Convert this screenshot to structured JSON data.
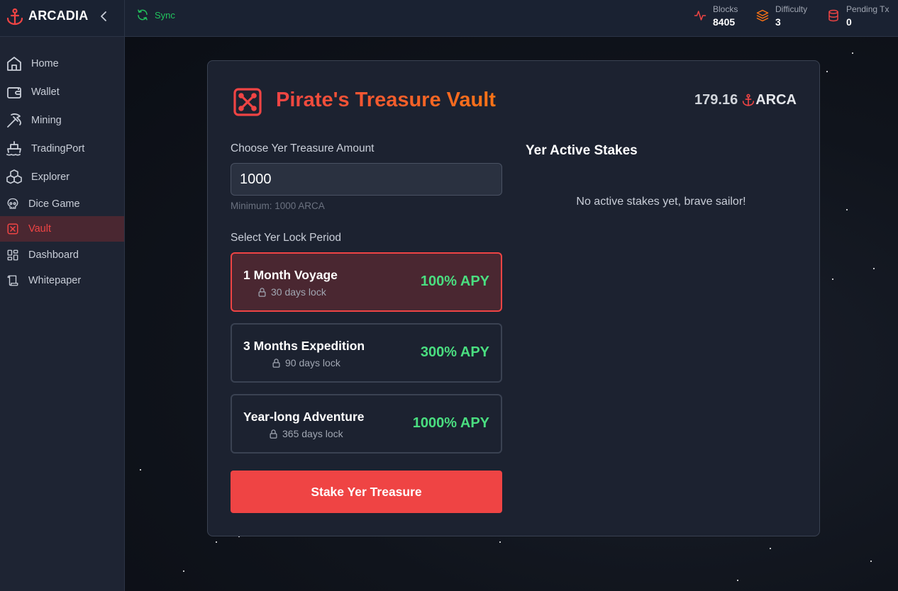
{
  "header": {
    "brand": "ARCADIA",
    "sync_label": "Sync",
    "stats": [
      {
        "label": "Blocks",
        "value": "8405",
        "icon": "activity-icon",
        "color": "#ef4444"
      },
      {
        "label": "Difficulty",
        "value": "3",
        "icon": "layers-icon",
        "color": "#f97316"
      },
      {
        "label": "Pending Tx",
        "value": "0",
        "icon": "database-icon",
        "color": "#ef4444"
      }
    ]
  },
  "sidebar": {
    "items": [
      {
        "label": "Home",
        "icon": "home-icon"
      },
      {
        "label": "Wallet",
        "icon": "wallet-icon"
      },
      {
        "label": "Mining",
        "icon": "pickaxe-icon"
      },
      {
        "label": "TradingPort",
        "icon": "ship-icon"
      },
      {
        "label": "Explorer",
        "icon": "boxes-icon"
      },
      {
        "label": "Dice Game",
        "icon": "skull-icon"
      },
      {
        "label": "Vault",
        "icon": "vault-icon",
        "active": true
      },
      {
        "label": "Dashboard",
        "icon": "dashboard-icon"
      },
      {
        "label": "Whitepaper",
        "icon": "scroll-icon"
      }
    ]
  },
  "vault": {
    "title": "Pirate's Treasure Vault",
    "balance_value": "179.16",
    "balance_unit": "ARCA",
    "amount_label": "Choose Yer Treasure Amount",
    "amount_value": "1000",
    "minimum_note": "Minimum: 1000 ARCA",
    "period_label": "Select Yer Lock Period",
    "periods": [
      {
        "name": "1 Month Voyage",
        "lock": "30 days lock",
        "apy": "100% APY",
        "selected": true
      },
      {
        "name": "3 Months Expedition",
        "lock": "90 days lock",
        "apy": "300% APY",
        "selected": false
      },
      {
        "name": "Year-long Adventure",
        "lock": "365 days lock",
        "apy": "1000% APY",
        "selected": false
      }
    ],
    "stake_button": "Stake Yer Treasure",
    "stakes_title": "Yer Active Stakes",
    "stakes_empty": "No active stakes yet, brave sailor!"
  },
  "colors": {
    "accent": "#ef4444",
    "apy_green": "#4ade80",
    "sync_green": "#22c55e"
  }
}
